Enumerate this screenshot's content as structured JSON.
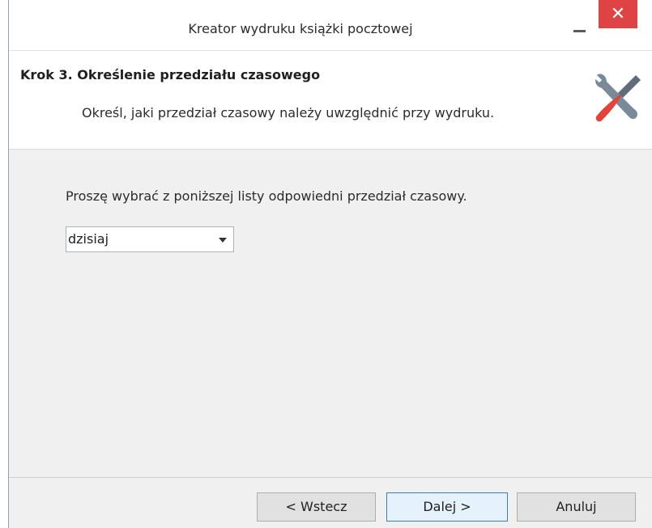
{
  "window": {
    "title": "Kreator wydruku książki pocztowej",
    "minimize_icon": "minimize-icon",
    "close_glyph": "✕"
  },
  "header": {
    "step_title": "Krok 3. Określenie przedziału czasowego",
    "step_description": "Określ, jaki przedział czasowy należy uwzględnić przy wydruku.",
    "icon": "tools-icon"
  },
  "content": {
    "prompt": "Proszę wybrać z poniższej listy odpowiedni przedział czasowy.",
    "time_range_select": {
      "value": "dzisiaj"
    }
  },
  "footer": {
    "back_label": "< Wstecz",
    "next_label": "Dalej >",
    "cancel_label": "Anuluj"
  },
  "colors": {
    "close_button": "#e04343",
    "next_button_border": "#3c7fb1",
    "wrench": "#7b8a99",
    "screwdriver_handle": "#e0443a"
  }
}
